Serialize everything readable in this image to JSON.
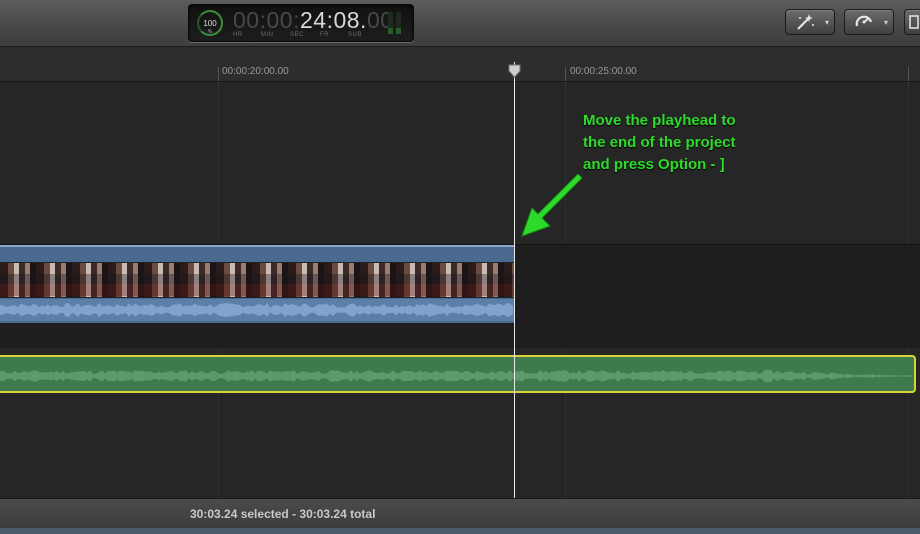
{
  "timecode": {
    "percent": "100",
    "percent_unit": "%",
    "hours": "00",
    "minutes": "00",
    "seconds": "24",
    "frames": "08",
    "subframes": "00",
    "unit_hr": "HR",
    "unit_min": "MIN",
    "unit_sec": "SEC",
    "unit_fr": "FR",
    "unit_sub": "SUB"
  },
  "toolbar": {
    "magic_wand_caret": "▾",
    "retiming_caret": "▾"
  },
  "ruler": {
    "tick_1": "00:00:20:00.00",
    "tick_2": "00:00:25:00.00"
  },
  "annotation": {
    "line_1": "Move the playhead to",
    "line_2": "the end of the project",
    "line_3": "and press Option - ]"
  },
  "status": {
    "text": "30:03.24 selected - 30:03.24 total"
  },
  "colors": {
    "annotation": "#2ddc2a",
    "video_clip": "#4a6a90",
    "audio_clip": "#3f7a4c",
    "selection": "#d9d33a"
  }
}
